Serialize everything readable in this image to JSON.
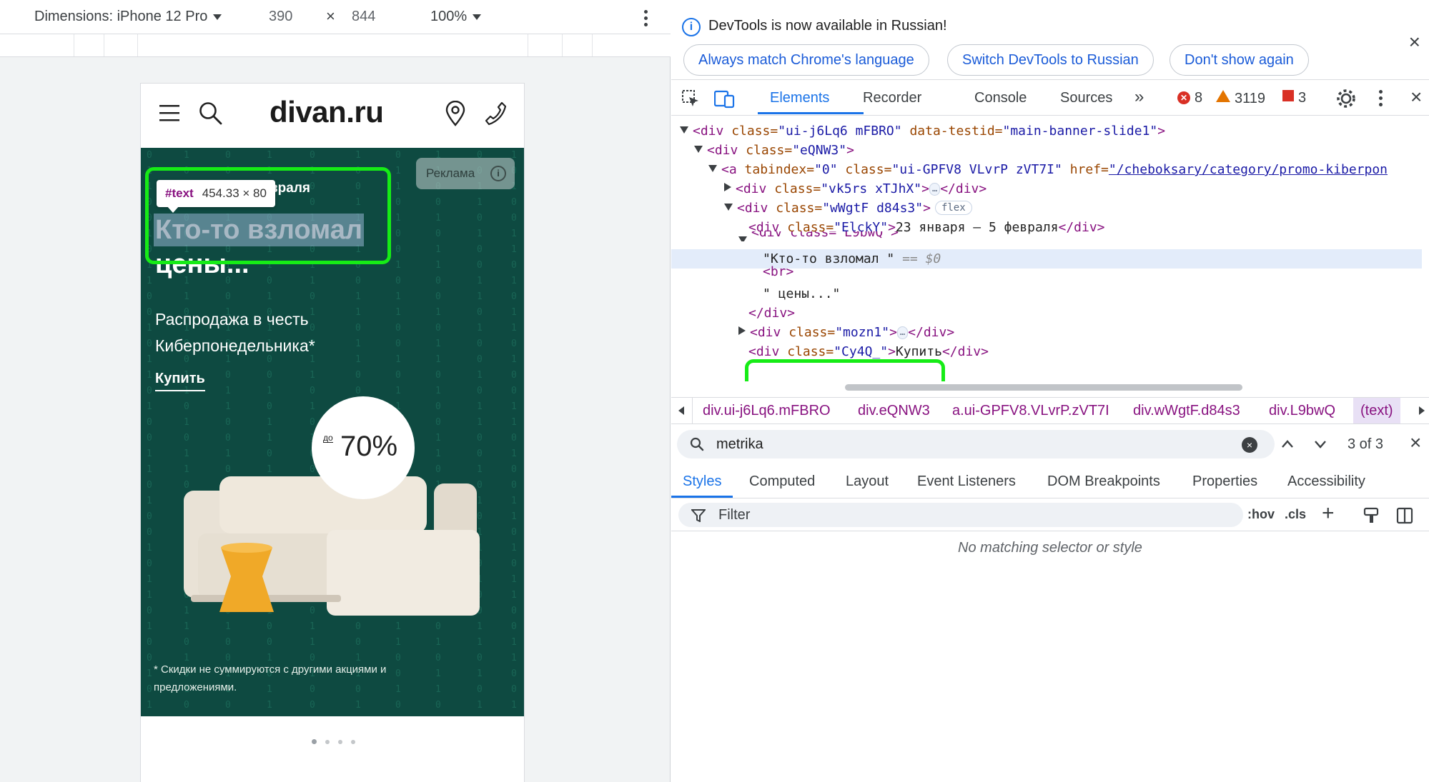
{
  "device_toolbar": {
    "dimensions_label": "Dimensions: iPhone 12 Pro",
    "width": "390",
    "times": "×",
    "height": "844",
    "zoom": "100%"
  },
  "site": {
    "logo": "divan.ru",
    "ad_badge": "Реклама",
    "ad_badge_icon": "i",
    "promo_date": "враля",
    "headline_line1": "Кто-то взломал",
    "headline_line2": "цены...",
    "subtitle": "Распродажа в честь Киберпонедельника*",
    "buy_link": "Купить",
    "discount_prefix": "до",
    "discount_value": "70%",
    "footnote": "* Скидки не суммируются с другими акциями и предложениями.",
    "banner_color": "#0e4a41",
    "carousel_active_index": 0,
    "carousel_count": 4
  },
  "inspect_tooltip": {
    "tag": "#text",
    "dims": "454.33 × 80"
  },
  "devtools": {
    "infobar": {
      "info_icon": "i",
      "message": "DevTools is now available in Russian!",
      "btn_match": "Always match Chrome's language",
      "btn_switch": "Switch DevTools to Russian",
      "btn_dismiss": "Don't show again",
      "close": "×"
    },
    "tabs": {
      "elements": "Elements",
      "recorder": "Recorder",
      "console": "Console",
      "sources": "Sources",
      "more": "»"
    },
    "counts": {
      "errors": "8",
      "warnings": "3119",
      "issues": "3"
    },
    "dom": {
      "line1": {
        "tag_open": "<div ",
        "attr1": "class=",
        "val1": "\"ui-j6Lq6 mFBRO\"",
        "attr2": " data-testid=",
        "val2": "\"main-banner-slide1\"",
        "tag_close": ">"
      },
      "line2": {
        "tag_open": "<div ",
        "attr1": "class=",
        "val1": "\"eQNW3\"",
        "tag_close": ">"
      },
      "line3": {
        "tag_open": "<a ",
        "attr1": "tabindex=",
        "val1": "\"0\"",
        "attr2": " class=",
        "val2": "\"ui-GPFV8 VLvrP zVT7I\"",
        "attr3": " href=",
        "val3": "\"/cheboksary/category/promo-kiberpon"
      },
      "line4": {
        "tag_open": "<div ",
        "attr1": "class=",
        "val1": "\"vk5rs xTJhX\"",
        "tag_mid": ">",
        "ellipsis": "…",
        "tag_close": "</div>"
      },
      "line5": {
        "tag_open": "<div ",
        "attr1": "class=",
        "val1": "\"wWgtF d84s3\"",
        "tag_close": ">",
        "badge": "flex"
      },
      "line6": {
        "tag_open": "<div ",
        "attr1": "class=",
        "val1": "\"ElckY\"",
        "tag_mid": ">",
        "text": "23 января – 5 февраля",
        "tag_close": "</div>"
      },
      "line7": {
        "text": "<div class=\"L9bwQ\">"
      },
      "line8": {
        "text": "\"Кто-то взломал \"",
        "ref": " == $0"
      },
      "line9": {
        "tag": "<br>"
      },
      "line10": {
        "text": "\" цены...\""
      },
      "line11": {
        "tag": "</div>"
      },
      "line12": {
        "tag_open": "<div ",
        "attr1": "class=",
        "val1": "\"mozn1\"",
        "tag_mid": ">",
        "ellipsis": "…",
        "tag_close": "</div>"
      },
      "line13": {
        "tag_open": "<div ",
        "attr1": "class=",
        "val1": "\"Cy4Q_\"",
        "tag_mid": ">",
        "text": "Купить",
        "tag_close": "</div>"
      }
    },
    "breadcrumbs": {
      "c1": "div.ui-j6Lq6.mFBRO",
      "c2": "div.eQNW3",
      "c3": "a.ui-GPFV8.VLvrP.zVT7I",
      "c4": "div.wWgtF.d84s3",
      "c5": "div.L9bwQ",
      "c6": "(text)"
    },
    "search": {
      "value": "metrika",
      "clear": "×",
      "match": "3 of 3",
      "close": "×"
    },
    "styles_tabs": {
      "styles": "Styles",
      "computed": "Computed",
      "layout": "Layout",
      "listeners": "Event Listeners",
      "dom_bp": "DOM Breakpoints",
      "properties": "Properties",
      "accessibility": "Accessibility"
    },
    "filter": {
      "placeholder": "Filter",
      "hov": ":hov",
      "cls": ".cls",
      "plus": "+"
    },
    "empty_message": "No matching selector or style"
  },
  "colors": {
    "accent": "#1a73e8",
    "highlight_green": "#16ec16",
    "banner_green": "#0e4a41"
  }
}
